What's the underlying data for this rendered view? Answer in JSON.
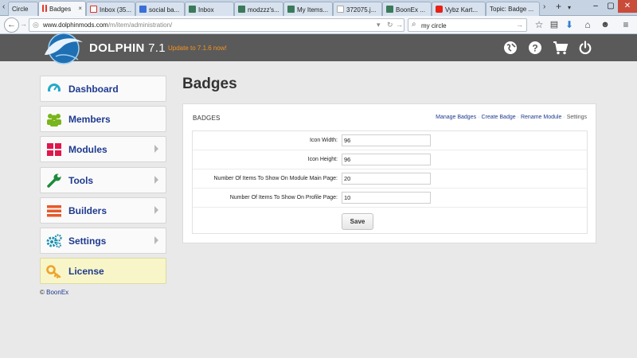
{
  "browser": {
    "tabs": [
      {
        "label": "Circle",
        "favicon_color": "#b0b0b0"
      },
      {
        "label": "Badges",
        "favicon_color": "#e23a2e"
      },
      {
        "label": "Inbox (35...",
        "favicon_color": "#d93025"
      },
      {
        "label": "social ba...",
        "favicon_color": "#3b6fd8"
      },
      {
        "label": "Inbox",
        "favicon_color": "#3a7a5a"
      },
      {
        "label": "modzzz's...",
        "favicon_color": "#3a7a5a"
      },
      {
        "label": "My Items...",
        "favicon_color": "#3a7a5a"
      },
      {
        "label": "372075.j...",
        "favicon_color": "#c9c9c9"
      },
      {
        "label": "BoonEx ...",
        "favicon_color": "#3a7a5a"
      },
      {
        "label": "Vybz Kart...",
        "favicon_color": "#e62117"
      },
      {
        "label": "Topic: Badge ...",
        "favicon_color": "#6e6e6e"
      }
    ],
    "tab_close_glyph": "×",
    "new_tab_glyph": "+",
    "url_host": "www.dolphinmods.com",
    "url_path": "/m/item/administration/",
    "search_value": "my circle"
  },
  "site": {
    "brand": "DOLPHIN",
    "version": "7.1",
    "update_text": "Update to 7.1.6 now!",
    "accent": "#f6941e",
    "link_color": "#1e3a8f"
  },
  "sidebar": {
    "items": [
      {
        "label": "Dashboard",
        "icon": "dashboard-icon",
        "icon_color": "#23a9c9",
        "has_arrow": false
      },
      {
        "label": "Members",
        "icon": "members-icon",
        "icon_color": "#79b51c",
        "has_arrow": false
      },
      {
        "label": "Modules",
        "icon": "modules-icon",
        "icon_color": "#e0174a",
        "has_arrow": true
      },
      {
        "label": "Tools",
        "icon": "tools-icon",
        "icon_color": "#1d8b3a",
        "has_arrow": true
      },
      {
        "label": "Builders",
        "icon": "builders-icon",
        "icon_color": "#e55a2b",
        "has_arrow": true
      },
      {
        "label": "Settings",
        "icon": "settings-icon",
        "icon_color": "#1a8fb0",
        "has_arrow": true
      },
      {
        "label": "License",
        "icon": "key-icon",
        "icon_color": "#f0a22b",
        "has_arrow": false
      }
    ],
    "copyright_symbol": "©",
    "copyright_link": "BoonEx"
  },
  "main": {
    "title": "Badges",
    "panel_title": "BADGES",
    "links": [
      {
        "label": "Manage Badges"
      },
      {
        "label": "Create Badge"
      },
      {
        "label": "Rename Module"
      },
      {
        "label": "Settings"
      }
    ],
    "fields": [
      {
        "label": "Icon Width:",
        "value": "96"
      },
      {
        "label": "Icon Height:",
        "value": "96"
      },
      {
        "label": "Number Of Items To Show On Module Main Page:",
        "value": "20"
      },
      {
        "label": "Number Of Items To Show On Profile Page:",
        "value": "10"
      }
    ],
    "save_label": "Save"
  }
}
